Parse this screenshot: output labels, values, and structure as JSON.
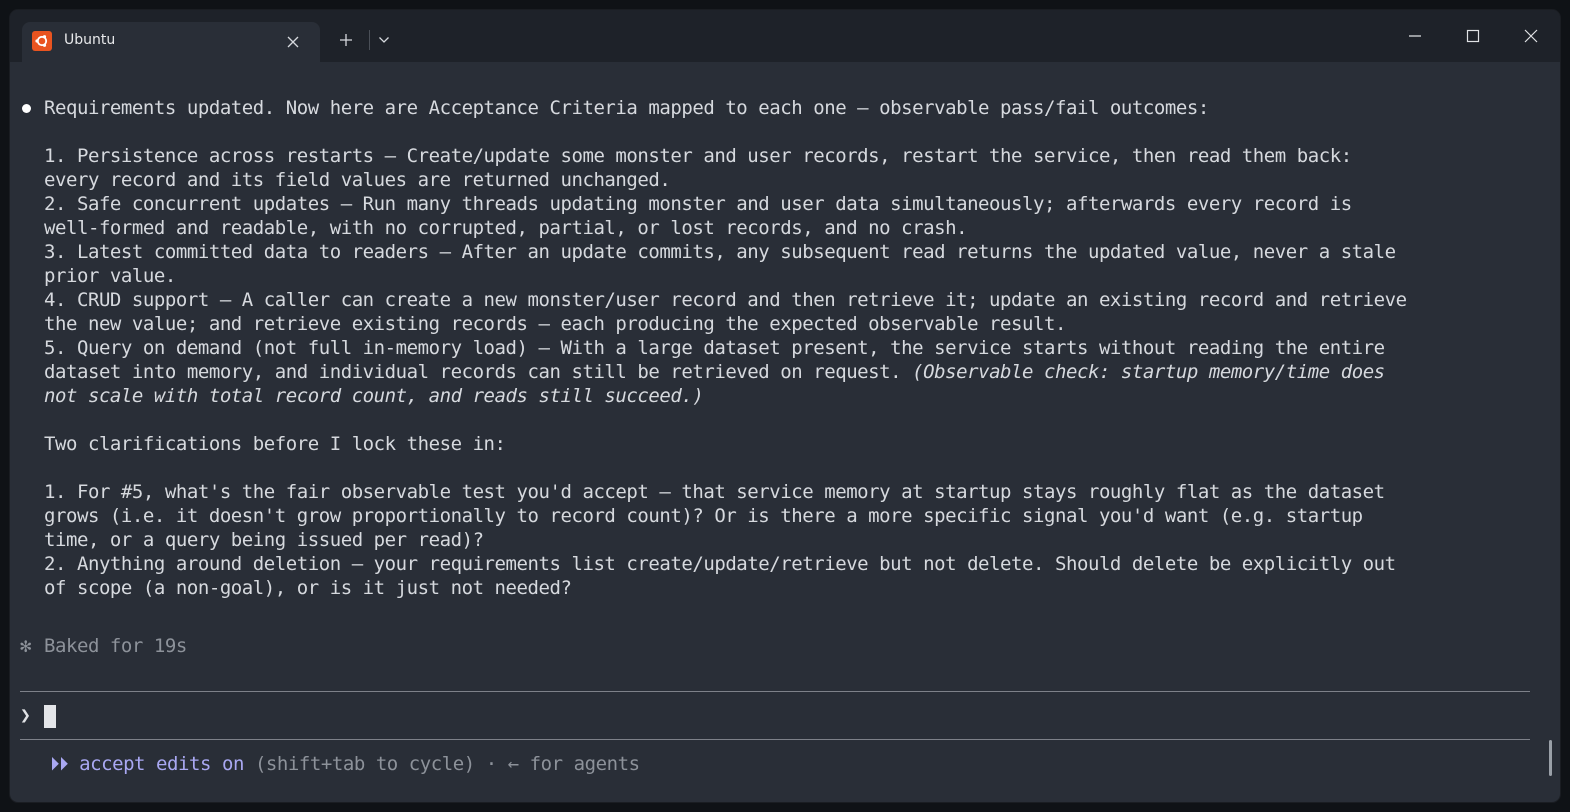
{
  "window": {
    "tab_title": "Ubuntu"
  },
  "terminal": {
    "lines": [
      "Requirements updated. Now here are Acceptance Criteria mapped to each one — observable pass/fail outcomes:",
      "",
      "1. Persistence across restarts — Create/update some monster and user records, restart the service, then read them back:",
      "every record and its field values are returned unchanged.",
      "2. Safe concurrent updates — Run many threads updating monster and user data simultaneously; afterwards every record is",
      "well-formed and readable, with no corrupted, partial, or lost records, and no crash.",
      "3. Latest committed data to readers — After an update commits, any subsequent read returns the updated value, never a stale",
      "prior value.",
      "4. CRUD support — A caller can create a new monster/user record and then retrieve it; update an existing record and retrieve",
      "the new value; and retrieve existing records — each producing the expected observable result.",
      "5. Query on demand (not full in-memory load) — With a large dataset present, the service starts without reading the entire",
      "dataset into memory, and individual records can still be retrieved on request. ",
      "",
      "",
      "Two clarifications before I lock these in:",
      "",
      "1. For #5, what's the fair observable test you'd accept — that service memory at startup stays roughly flat as the dataset",
      "grows (i.e. it doesn't grow proportionally to record count)? Or is there a more specific signal you'd want (e.g. startup",
      "time, or a query being issued per read)?",
      "2. Anything around deletion — your requirements list create/update/retrieve but not delete. Should delete be explicitly out",
      "of scope (a non-goal), or is it just not needed?"
    ],
    "italic_1": "(Observable check: startup memory/time does",
    "italic_2": "not scale with total record count, and reads still succeed.)",
    "status_glyph": "✻",
    "status_text": "Baked for 19s",
    "prompt_glyph": "❯",
    "mode_glyph": "⏵⏵",
    "mode_accent": "accept edits on",
    "mode_hint": " (shift+tab to cycle) · ← for agents"
  }
}
